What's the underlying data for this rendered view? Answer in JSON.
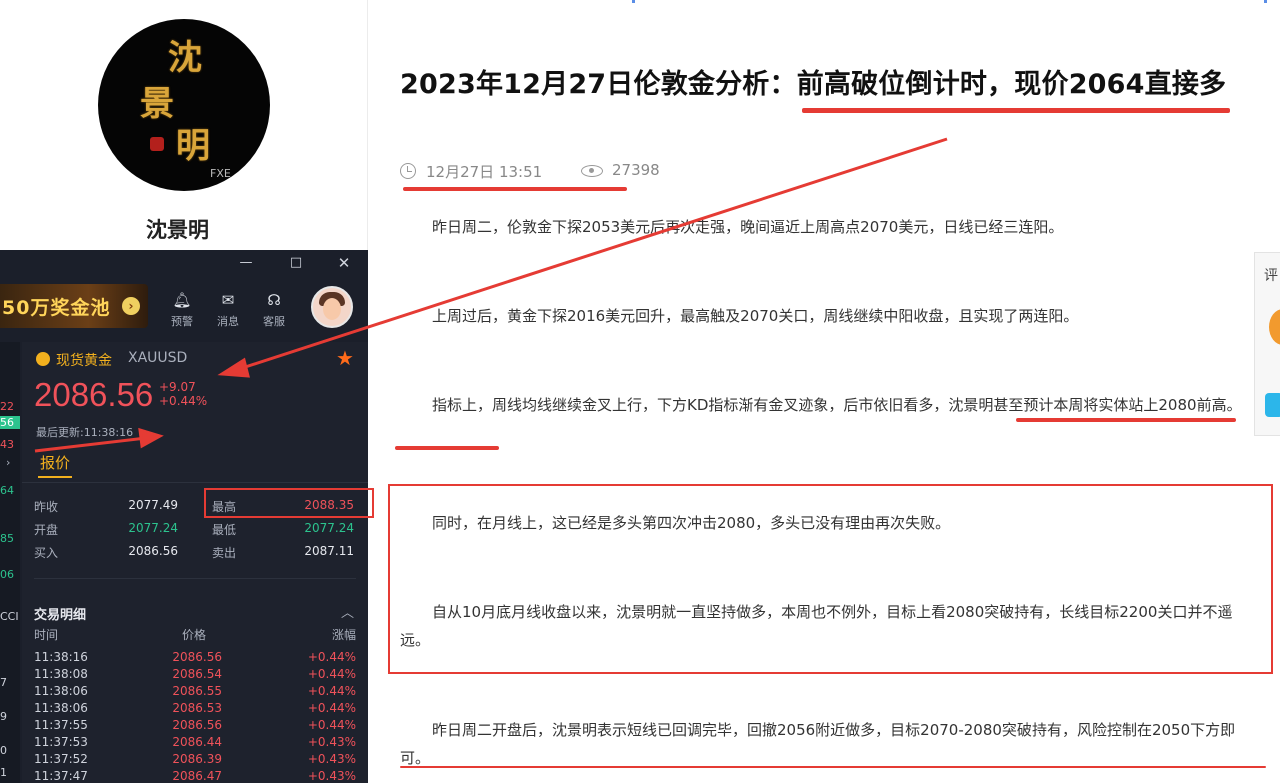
{
  "profile": {
    "avatar_chars": [
      "沈",
      "景",
      "明"
    ],
    "avatar_tag": "FXE",
    "name": "沈景明"
  },
  "app": {
    "window": {
      "minimize": "—",
      "maximize": "□",
      "close": "✕"
    },
    "banner_text": "50万奖金池",
    "toolbar": [
      {
        "icon": "bell-icon",
        "label": "预警"
      },
      {
        "icon": "mail-icon",
        "label": "消息"
      },
      {
        "icon": "headset-icon",
        "label": "客服"
      }
    ],
    "side_values": [
      "22",
      "56",
      "43",
      "64",
      "85",
      "06",
      "CCI",
      "7",
      "9",
      "0",
      "1"
    ],
    "symbol": {
      "name": "现货黄金",
      "code": "XAUUSD",
      "price": "2086.56",
      "change_abs": "+9.07",
      "change_pct": "+0.44%",
      "updated": "最后更新:11:38:16"
    },
    "tab_label": "报价",
    "quote_rows": [
      {
        "l1": "昨收",
        "v1": "2077.49",
        "l2": "最高",
        "v2": "2088.35"
      },
      {
        "l1": "开盘",
        "v1": "2077.24",
        "l2": "最低",
        "v2": "2077.24"
      },
      {
        "l1": "买入",
        "v1": "2086.56",
        "l2": "卖出",
        "v2": "2087.11"
      }
    ],
    "trades": {
      "title": "交易明细",
      "columns": [
        "时间",
        "价格",
        "涨幅"
      ],
      "rows": [
        {
          "time": "11:38:16",
          "price": "2086.56",
          "pct": "+0.44%"
        },
        {
          "time": "11:38:08",
          "price": "2086.54",
          "pct": "+0.44%"
        },
        {
          "time": "11:38:06",
          "price": "2086.55",
          "pct": "+0.44%"
        },
        {
          "time": "11:38:06",
          "price": "2086.53",
          "pct": "+0.44%"
        },
        {
          "time": "11:37:55",
          "price": "2086.56",
          "pct": "+0.44%"
        },
        {
          "time": "11:37:53",
          "price": "2086.44",
          "pct": "+0.43%"
        },
        {
          "time": "11:37:52",
          "price": "2086.39",
          "pct": "+0.43%"
        },
        {
          "time": "11:37:47",
          "price": "2086.47",
          "pct": "+0.43%"
        }
      ]
    }
  },
  "article": {
    "title": "2023年12月27日伦敦金分析：前高破位倒计时，现价2064直接多",
    "date": "12月27日 13:51",
    "views": "27398",
    "paragraphs": [
      "昨日周二，伦敦金下探2053美元后再次走强，晚间逼近上周高点2070美元，日线已经三连阳。",
      "上周过后，黄金下探2016美元回升，最高触及2070关口，周线继续中阳收盘，且实现了两连阳。",
      "指标上，周线均线继续金叉上行，下方KD指标渐有金叉迹象，后市依旧看多，沈景明甚至预计本周将实体站上2080前高。",
      "同时，在月线上，这已经是多头第四次冲击2080，多头已没有理由再次失败。",
      "自从10月底月线收盘以来，沈景明就一直坚持做多，本周也不例外，目标上看2080突破持有，长线目标2200关口并不遥远。",
      "昨日周二开盘后，沈景明表示短线已回调完毕，回撤2056附近做多，目标2070-2080突破持有，风险控制在2050下方即可。"
    ]
  },
  "float_panel": {
    "label": "评"
  },
  "annotation_color": "#e53b34"
}
